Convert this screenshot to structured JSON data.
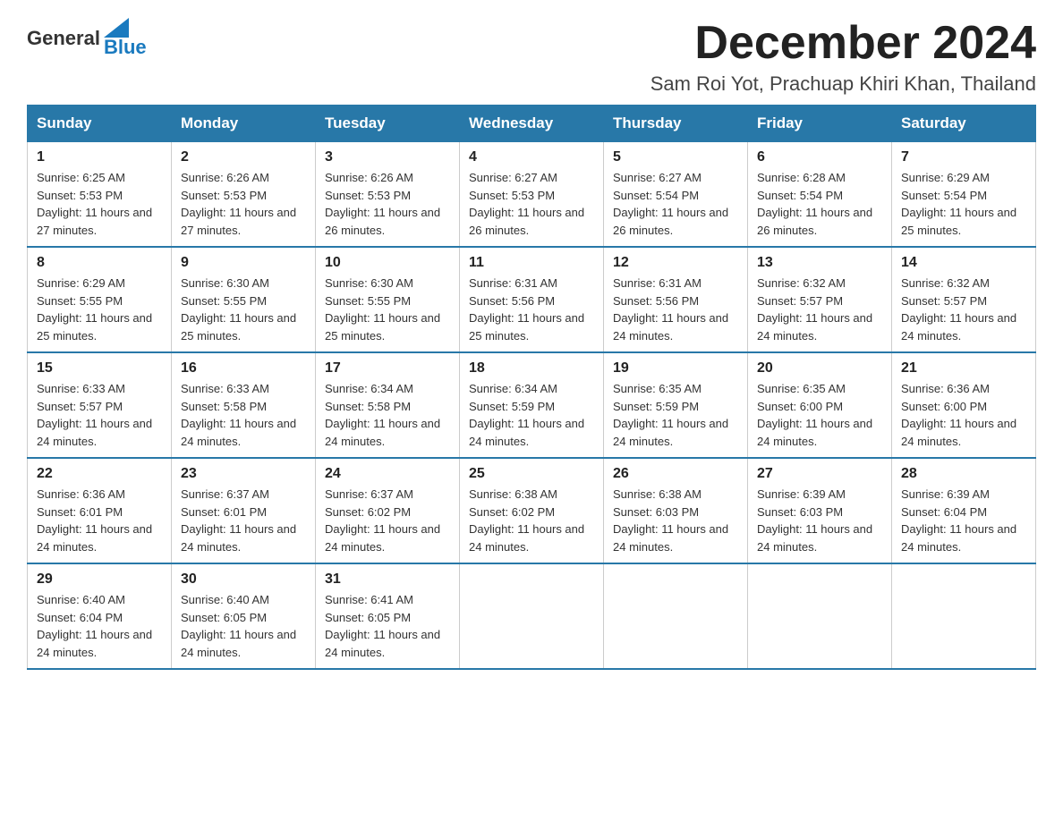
{
  "header": {
    "logo_general": "General",
    "logo_blue": "Blue",
    "month_title": "December 2024",
    "location": "Sam Roi Yot, Prachuap Khiri Khan, Thailand"
  },
  "days_of_week": [
    "Sunday",
    "Monday",
    "Tuesday",
    "Wednesday",
    "Thursday",
    "Friday",
    "Saturday"
  ],
  "weeks": [
    [
      {
        "day": "1",
        "sunrise": "6:25 AM",
        "sunset": "5:53 PM",
        "daylight": "11 hours and 27 minutes."
      },
      {
        "day": "2",
        "sunrise": "6:26 AM",
        "sunset": "5:53 PM",
        "daylight": "11 hours and 27 minutes."
      },
      {
        "day": "3",
        "sunrise": "6:26 AM",
        "sunset": "5:53 PM",
        "daylight": "11 hours and 26 minutes."
      },
      {
        "day": "4",
        "sunrise": "6:27 AM",
        "sunset": "5:53 PM",
        "daylight": "11 hours and 26 minutes."
      },
      {
        "day": "5",
        "sunrise": "6:27 AM",
        "sunset": "5:54 PM",
        "daylight": "11 hours and 26 minutes."
      },
      {
        "day": "6",
        "sunrise": "6:28 AM",
        "sunset": "5:54 PM",
        "daylight": "11 hours and 26 minutes."
      },
      {
        "day": "7",
        "sunrise": "6:29 AM",
        "sunset": "5:54 PM",
        "daylight": "11 hours and 25 minutes."
      }
    ],
    [
      {
        "day": "8",
        "sunrise": "6:29 AM",
        "sunset": "5:55 PM",
        "daylight": "11 hours and 25 minutes."
      },
      {
        "day": "9",
        "sunrise": "6:30 AM",
        "sunset": "5:55 PM",
        "daylight": "11 hours and 25 minutes."
      },
      {
        "day": "10",
        "sunrise": "6:30 AM",
        "sunset": "5:55 PM",
        "daylight": "11 hours and 25 minutes."
      },
      {
        "day": "11",
        "sunrise": "6:31 AM",
        "sunset": "5:56 PM",
        "daylight": "11 hours and 25 minutes."
      },
      {
        "day": "12",
        "sunrise": "6:31 AM",
        "sunset": "5:56 PM",
        "daylight": "11 hours and 24 minutes."
      },
      {
        "day": "13",
        "sunrise": "6:32 AM",
        "sunset": "5:57 PM",
        "daylight": "11 hours and 24 minutes."
      },
      {
        "day": "14",
        "sunrise": "6:32 AM",
        "sunset": "5:57 PM",
        "daylight": "11 hours and 24 minutes."
      }
    ],
    [
      {
        "day": "15",
        "sunrise": "6:33 AM",
        "sunset": "5:57 PM",
        "daylight": "11 hours and 24 minutes."
      },
      {
        "day": "16",
        "sunrise": "6:33 AM",
        "sunset": "5:58 PM",
        "daylight": "11 hours and 24 minutes."
      },
      {
        "day": "17",
        "sunrise": "6:34 AM",
        "sunset": "5:58 PM",
        "daylight": "11 hours and 24 minutes."
      },
      {
        "day": "18",
        "sunrise": "6:34 AM",
        "sunset": "5:59 PM",
        "daylight": "11 hours and 24 minutes."
      },
      {
        "day": "19",
        "sunrise": "6:35 AM",
        "sunset": "5:59 PM",
        "daylight": "11 hours and 24 minutes."
      },
      {
        "day": "20",
        "sunrise": "6:35 AM",
        "sunset": "6:00 PM",
        "daylight": "11 hours and 24 minutes."
      },
      {
        "day": "21",
        "sunrise": "6:36 AM",
        "sunset": "6:00 PM",
        "daylight": "11 hours and 24 minutes."
      }
    ],
    [
      {
        "day": "22",
        "sunrise": "6:36 AM",
        "sunset": "6:01 PM",
        "daylight": "11 hours and 24 minutes."
      },
      {
        "day": "23",
        "sunrise": "6:37 AM",
        "sunset": "6:01 PM",
        "daylight": "11 hours and 24 minutes."
      },
      {
        "day": "24",
        "sunrise": "6:37 AM",
        "sunset": "6:02 PM",
        "daylight": "11 hours and 24 minutes."
      },
      {
        "day": "25",
        "sunrise": "6:38 AM",
        "sunset": "6:02 PM",
        "daylight": "11 hours and 24 minutes."
      },
      {
        "day": "26",
        "sunrise": "6:38 AM",
        "sunset": "6:03 PM",
        "daylight": "11 hours and 24 minutes."
      },
      {
        "day": "27",
        "sunrise": "6:39 AM",
        "sunset": "6:03 PM",
        "daylight": "11 hours and 24 minutes."
      },
      {
        "day": "28",
        "sunrise": "6:39 AM",
        "sunset": "6:04 PM",
        "daylight": "11 hours and 24 minutes."
      }
    ],
    [
      {
        "day": "29",
        "sunrise": "6:40 AM",
        "sunset": "6:04 PM",
        "daylight": "11 hours and 24 minutes."
      },
      {
        "day": "30",
        "sunrise": "6:40 AM",
        "sunset": "6:05 PM",
        "daylight": "11 hours and 24 minutes."
      },
      {
        "day": "31",
        "sunrise": "6:41 AM",
        "sunset": "6:05 PM",
        "daylight": "11 hours and 24 minutes."
      },
      null,
      null,
      null,
      null
    ]
  ]
}
